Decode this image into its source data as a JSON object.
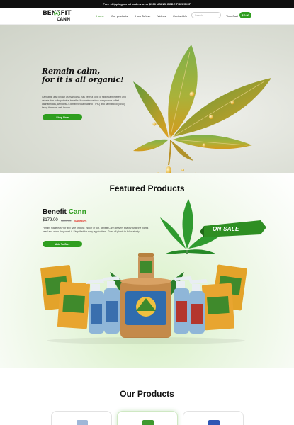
{
  "topbar": {
    "text": "Free shipping on all orders over $100 USING CODE FREESHIP"
  },
  "logo": {
    "line1": "BENEFIT",
    "line2": "CANN"
  },
  "nav": {
    "items": [
      "Home",
      "Our products",
      "How To Use",
      "Videos",
      "Contact Us"
    ],
    "active": "Home"
  },
  "search": {
    "placeholder": "Search..."
  },
  "cart": {
    "label": "Your Cart",
    "amount": "$ 0.00"
  },
  "hero": {
    "title_line1": "Remain calm,",
    "title_line2": "for it is all organic!",
    "text": "Cannabis, also known as marijuana, has been a topic of significant interest and debate due to its potential benefits. It contains various compounds called cannabinoids, with delta-9-tetrahydrocannabinol (THC) and cannabidiol (CBD) being the most well-known.",
    "button": "Shop Now"
  },
  "featured": {
    "title": "Featured Products",
    "product_name_1": "Benefit",
    "product_name_2": "Cann",
    "price": "$179.00",
    "price_old": "$299.00",
    "save": "Save40%",
    "description": "Fertility made easy for any type of grow, indoor or out. Benefit Cann delivers exactly what the plants need and when they need it. Simplified for easy applications. Grow all plants to full maturity.",
    "button": "Add To Cart",
    "badge": "ON SALE"
  },
  "our_products": {
    "title": "Our Products"
  },
  "colors": {
    "accent": "#2f9e1f",
    "sale_red": "#e1251b",
    "topbar": "#0f0f0f"
  }
}
